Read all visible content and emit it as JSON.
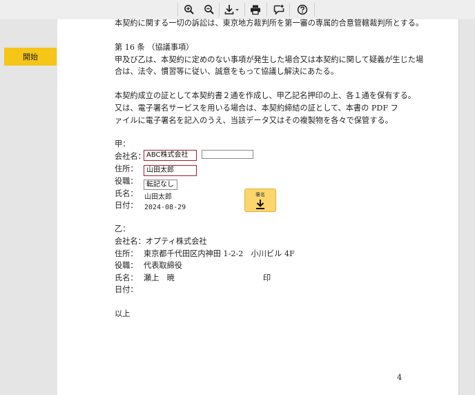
{
  "toolbar": {
    "zoom_in": "zoom-in-icon",
    "zoom_out": "zoom-out-icon",
    "download": "download-icon",
    "print": "print-icon",
    "comment": "comment-icon",
    "help": "help-icon"
  },
  "sidebar": {
    "start_label": "開始"
  },
  "document": {
    "line_court": "本契約に関する一切の訴訟は、東京地方裁判所を第一審の専属的合意管轄裁判所とする。",
    "article_heading": "第 16 条 （協議事項）",
    "article_line1": "甲及び乙は、本契約に定めのない事項が発生した場合又は本契約に関して疑義が生じた場",
    "article_line2": "合は、法令、慣習等に従い、誠意をもって協議し解決にあたる。",
    "proof_line1": "本契約成立の証として本契約書２通を作成し、甲乙記名押印の上、各１通を保有する。",
    "proof_line2": "又は、電子署名サービスを用いる場合は、本契約締結の証として、本書の PDF フ",
    "proof_line3": "ァイルに電子署名を記入のうえ、当該データ又はその複製物を各々で保管する。",
    "party_a": {
      "heading": "甲：",
      "company_label": "会社名：",
      "company_value": "ABC株式会社",
      "address_label": "住所：",
      "address_value": "山田太郎",
      "title_label": "役職：",
      "title_value": "転記なし",
      "name_label": "氏名：",
      "name_value": "山田太郎",
      "date_label": "日付：",
      "date_value": "2024-08-29",
      "sign_label": "署名"
    },
    "party_b": {
      "heading": "乙：",
      "company_line": "会社名：オプティ株式会社",
      "address_label": "住所：",
      "address_value": "東京都千代田区内神田 1-2-2　小川ビル 4F",
      "title_label": "役職：",
      "title_value": "代表取締役",
      "name_label": "氏名：",
      "name_value": "瀬上　暁",
      "seal": "印",
      "date_label": "日付："
    },
    "closing": "以上",
    "page_number": "4"
  }
}
